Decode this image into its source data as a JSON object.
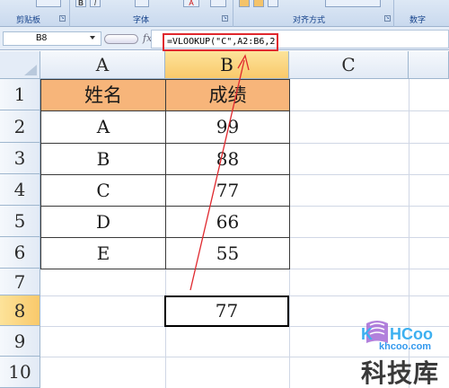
{
  "ribbon": {
    "groups": [
      {
        "label": "剪贴板"
      },
      {
        "label": "字体"
      },
      {
        "label": "对齐方式"
      },
      {
        "label": "数字"
      }
    ]
  },
  "formula_bar": {
    "name_box": "B8",
    "fx": "fx",
    "formula": "=VLOOKUP(\"C\",A2:B6,2)"
  },
  "sheet": {
    "columns": [
      "A",
      "B",
      "C"
    ],
    "active_column": "B",
    "rows": [
      "1",
      "2",
      "3",
      "4",
      "5",
      "6",
      "7",
      "8",
      "9",
      "10"
    ],
    "active_row": "8",
    "header": {
      "name": "姓名",
      "score": "成绩"
    },
    "records": [
      {
        "name": "A",
        "score": "99"
      },
      {
        "name": "B",
        "score": "88"
      },
      {
        "name": "C",
        "score": "77"
      },
      {
        "name": "D",
        "score": "66"
      },
      {
        "name": "E",
        "score": "55"
      }
    ],
    "result_cell": {
      "address": "B8",
      "value": "77"
    }
  },
  "colors": {
    "header_fill": "#f7b57a",
    "annotation_red": "#e0282e",
    "active_header": "#f9c96b"
  },
  "watermark": {
    "logo_text": "KHCoo",
    "site": "khcoo.com",
    "name": "科技库"
  }
}
